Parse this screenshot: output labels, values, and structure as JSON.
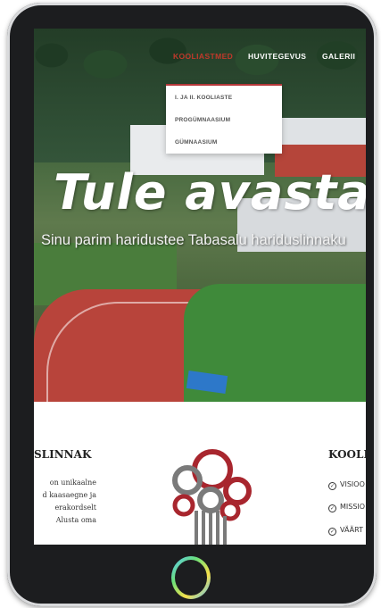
{
  "nav": {
    "items": [
      {
        "label": "KOOLIASTMED",
        "active": true
      },
      {
        "label": "HUVITEGEVUS",
        "active": false
      },
      {
        "label": "GALERII",
        "active": false
      }
    ],
    "dropdown": [
      "I. JA II. KOOLIASTE",
      "PROGÜMNAASIUM",
      "GÜMNAASIUM"
    ]
  },
  "hero": {
    "title": "Tule avasta",
    "subtitle": "Sinu parim haridustee Tabasalu hariduslinnaku"
  },
  "content": {
    "left_heading": "SLINNAK",
    "left_paragraph_lines": [
      "on    unikaalne",
      "d  kaasaegne  ja",
      "erakordselt",
      "Alusta   oma"
    ],
    "right_heading": "KOOLI",
    "right_list": [
      "VISIOO",
      "MISSIO",
      "VÄÄRT"
    ]
  },
  "colors": {
    "accent": "#b5373a",
    "logo_red": "#a8262e",
    "logo_gray": "#7a7a7a"
  }
}
